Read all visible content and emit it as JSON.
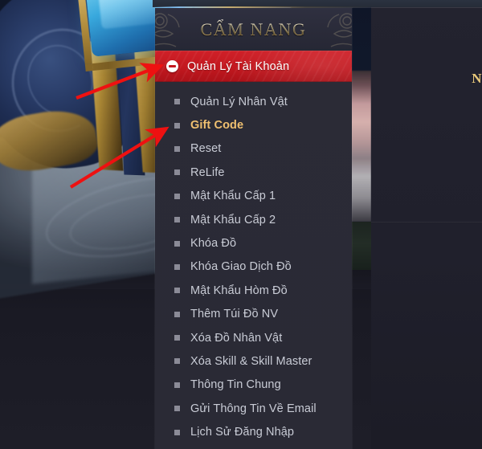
{
  "panel": {
    "title": "CẨM NANG",
    "active_section": {
      "label": "Quản Lý Tài Khoản",
      "icon": "minus-circle-icon",
      "expanded": true,
      "background_color": "#c2181f"
    },
    "menu_items": [
      {
        "label": "Quản Lý Nhân Vật",
        "highlighted": false
      },
      {
        "label": "Gift Code",
        "highlighted": true
      },
      {
        "label": "Reset",
        "highlighted": false
      },
      {
        "label": "ReLife",
        "highlighted": false
      },
      {
        "label": "Mật Khẩu Cấp 1",
        "highlighted": false
      },
      {
        "label": "Mật Khẩu Cấp 2",
        "highlighted": false
      },
      {
        "label": "Khóa Đồ",
        "highlighted": false
      },
      {
        "label": "Khóa Giao Dịch Đồ",
        "highlighted": false
      },
      {
        "label": "Mật Khẩu Hòm Đồ",
        "highlighted": false
      },
      {
        "label": "Thêm Túi Đồ NV",
        "highlighted": false
      },
      {
        "label": "Xóa Đồ Nhân Vật",
        "highlighted": false
      },
      {
        "label": "Xóa Skill & Skill Master",
        "highlighted": false
      },
      {
        "label": "Thông Tin Chung",
        "highlighted": false
      },
      {
        "label": "Gửi Thông Tin Về Email",
        "highlighted": false
      },
      {
        "label": "Lịch Sử Đăng Nhập",
        "highlighted": false
      }
    ]
  },
  "annotations": {
    "arrow_color": "#ee1111",
    "arrows": [
      {
        "name": "arrow-to-account-section",
        "points_to": "Quản Lý Tài Khoản"
      },
      {
        "name": "arrow-to-gift-code",
        "points_to": "Gift Code"
      }
    ]
  },
  "right_edge": {
    "partial_text": "N",
    "color": "#e8c87a"
  },
  "colors": {
    "panel_bg": "#2a2a35",
    "header_bg": "#2a2b39",
    "accent_red": "#c2181f",
    "title_gold": "#f3e3b4",
    "highlight_gold": "#f0c070",
    "menu_text": "#c9ccd6",
    "bullet": "#8b8b97"
  }
}
